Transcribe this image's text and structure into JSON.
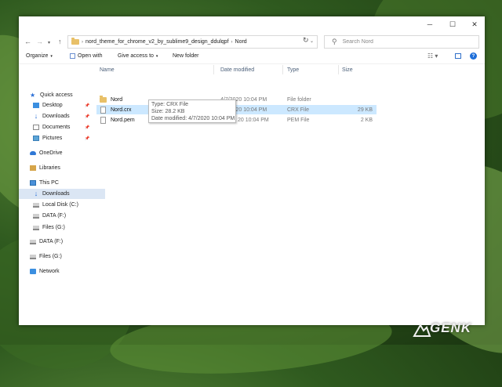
{
  "window": {
    "controls": {
      "minimize": "─",
      "maximize": "☐",
      "close": "✕"
    }
  },
  "address": {
    "path": [
      "nord_theme_for_chrome_v2_by_sublime9_design_ddulqpf",
      "Nord"
    ],
    "search_placeholder": "Search Nord"
  },
  "toolbar": {
    "organize": "Organize",
    "open_with": "Open with",
    "give_access": "Give access to",
    "new_folder": "New folder"
  },
  "nav": {
    "quick_access": "Quick access",
    "desktop": "Desktop",
    "downloads_pinned": "Downloads",
    "documents": "Documents",
    "pictures": "Pictures",
    "onedrive": "OneDrive",
    "libraries": "Libraries",
    "this_pc": "This PC",
    "downloads_pc": "Downloads",
    "local_disk": "Local Disk (C:)",
    "data_f_pc": "DATA (F:)",
    "files_g_pc": "Files (G:)",
    "data_f": "DATA (F:)",
    "files_g": "Files (G:)",
    "network": "Network"
  },
  "columns": {
    "name": "Name",
    "date": "Date modified",
    "type": "Type",
    "size": "Size"
  },
  "files": [
    {
      "name": "Nord",
      "date": "4/7/2020 10:04 PM",
      "type": "File folder",
      "size": ""
    },
    {
      "name": "Nord.crx",
      "date": "4/7/2020 10:04 PM",
      "type": "CRX File",
      "size": "29 KB"
    },
    {
      "name": "Nord.pem",
      "date": "20 10:04 PM",
      "type": "PEM File",
      "size": "2 KB"
    }
  ],
  "tooltip": {
    "type": "Type: CRX File",
    "size": "Size: 28.2 KB",
    "date": "Date modified: 4/7/2020 10:04 PM"
  },
  "watermark": {
    "text": "GENK"
  },
  "colors": {
    "accent": "#1e6fd9",
    "selection": "#cce8ff",
    "nav_selection": "#dbe6f4"
  }
}
